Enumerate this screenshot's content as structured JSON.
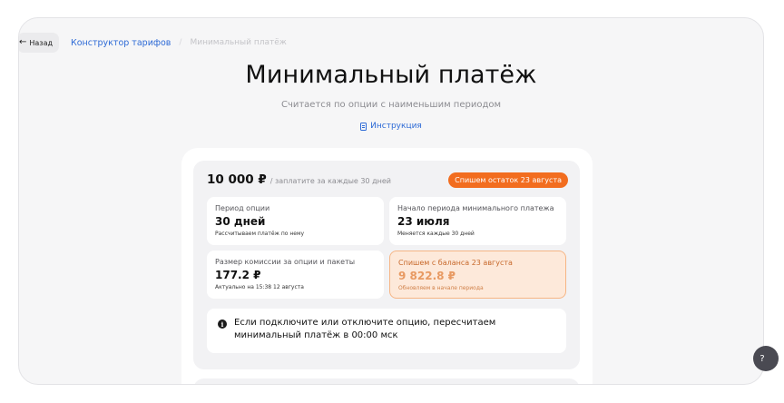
{
  "nav": {
    "back_label": "Назад",
    "breadcrumb_link": "Конструктор тарифов",
    "breadcrumb_current": "Минимальный платёж"
  },
  "header": {
    "title": "Минимальный платёж",
    "subtitle": "Считается по опции с наименьшим периодом",
    "instruction_link": "Инструкция"
  },
  "summary": {
    "amount": "10 000 ₽",
    "amount_note": "/ заплатите за каждые 30 дней",
    "badge": "Спишем остаток 23 августа"
  },
  "tiles": [
    {
      "label": "Период опции",
      "value": "30 дней",
      "sub": "Рассчитываем платёж по нему"
    },
    {
      "label": "Начало периода минимального платежа",
      "value": "23 июля",
      "sub": "Меняется каждые 30 дней"
    },
    {
      "label": "Размер комиссии за опции и пакеты",
      "value": "177.2 ₽",
      "sub": "Актуально на 15:38 12 августа"
    },
    {
      "label": "Спишем с баланса 23 августа",
      "value": "9 822.8 ₽",
      "sub": "Обновляем в начале периода"
    }
  ],
  "info": {
    "text": "Если подключите или отключите опцию, пересчитаем минимальный платёж в 00:00 мск"
  },
  "colors": {
    "accent_blue": "#2d6ad6",
    "badge_orange": "#f26d1f",
    "highlight_tile_bg": "#fde9da"
  },
  "icons": {
    "back": "arrow-left-icon",
    "instruction": "document-icon",
    "info": "info-icon",
    "help_fab": "help-icon"
  }
}
